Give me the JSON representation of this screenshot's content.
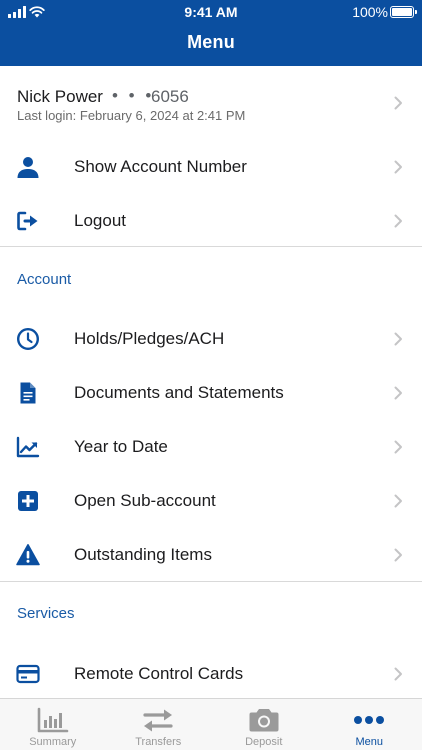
{
  "status_bar": {
    "time": "9:41 AM",
    "battery": "100%"
  },
  "header": {
    "title": "Menu"
  },
  "profile": {
    "name": "Nick Power",
    "dots": "• • •",
    "account_suffix": "6056",
    "last_login": "Last login: February 6, 2024 at 2:41 PM"
  },
  "top_items": [
    {
      "label": "Show Account Number",
      "icon": "person-icon"
    },
    {
      "label": "Logout",
      "icon": "logout-icon"
    }
  ],
  "sections": {
    "account": {
      "label": "Account",
      "items": [
        {
          "label": "Holds/Pledges/ACH",
          "icon": "clock-icon"
        },
        {
          "label": "Documents and Statements",
          "icon": "document-icon"
        },
        {
          "label": "Year to Date",
          "icon": "trend-chart-icon"
        },
        {
          "label": "Open Sub-account",
          "icon": "plus-square-icon"
        },
        {
          "label": "Outstanding Items",
          "icon": "warning-icon"
        }
      ]
    },
    "services": {
      "label": "Services",
      "items": [
        {
          "label": "Remote Control Cards",
          "icon": "credit-card-icon"
        }
      ]
    }
  },
  "tabs": [
    {
      "label": "Summary",
      "icon": "bar-chart-icon",
      "active": false
    },
    {
      "label": "Transfers",
      "icon": "transfer-arrows-icon",
      "active": false
    },
    {
      "label": "Deposit",
      "icon": "camera-icon",
      "active": false
    },
    {
      "label": "Menu",
      "icon": "ellipsis-icon",
      "active": true
    }
  ],
  "colors": {
    "brand": "#0b4fa0",
    "section_label": "#1a5ba6",
    "tab_inactive": "#9a9a9a",
    "divider": "#d9d9d9"
  }
}
